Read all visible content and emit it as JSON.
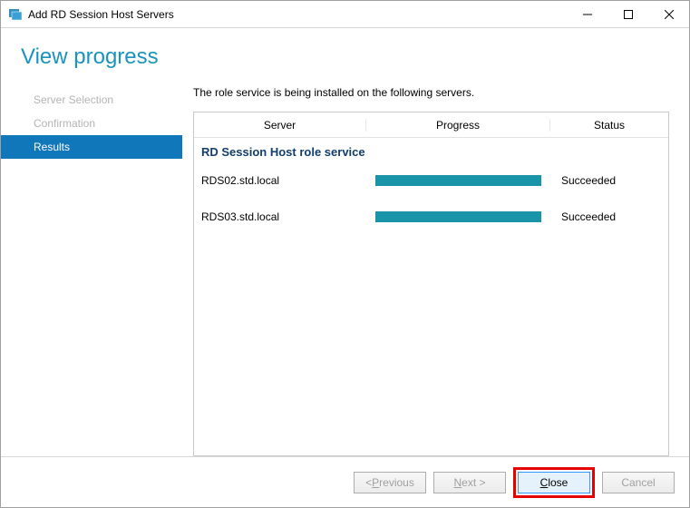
{
  "titlebar": {
    "title": "Add RD Session Host Servers"
  },
  "heading": "View progress",
  "sidebar": {
    "items": [
      {
        "label": "Server Selection"
      },
      {
        "label": "Confirmation"
      },
      {
        "label": "Results"
      }
    ]
  },
  "main": {
    "description": "The role service is being installed on the following servers.",
    "columns": {
      "server": "Server",
      "progress": "Progress",
      "status": "Status"
    },
    "section_title": "RD Session Host role service",
    "rows": [
      {
        "server": "RDS02.std.local",
        "progress": 100,
        "status": "Succeeded"
      },
      {
        "server": "RDS03.std.local",
        "progress": 100,
        "status": "Succeeded"
      }
    ]
  },
  "footer": {
    "previous_prefix": "< ",
    "previous_u": "P",
    "previous_rest": "revious",
    "next_u": "N",
    "next_rest": "ext >",
    "close_u": "C",
    "close_rest": "lose",
    "cancel": "Cancel"
  }
}
